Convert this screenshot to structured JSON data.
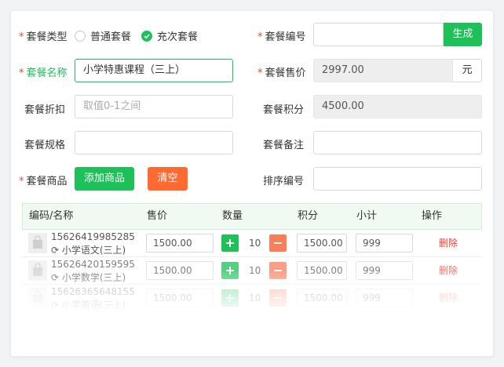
{
  "form": {
    "package_type": {
      "label": "套餐类型",
      "options": [
        "普通套餐",
        "充次套餐"
      ],
      "selected": 1
    },
    "package_code": {
      "label": "套餐编号",
      "value": "",
      "button": "生成"
    },
    "package_name": {
      "label": "套餐名称",
      "value": "小学特惠课程（三上）"
    },
    "package_price": {
      "label": "套餐售价",
      "value": "2997.00",
      "unit": "元"
    },
    "package_discount": {
      "label": "套餐折扣",
      "placeholder": "取值0-1之间"
    },
    "package_points": {
      "label": "套餐积分",
      "value": "4500.00"
    },
    "package_spec": {
      "label": "套餐规格",
      "value": ""
    },
    "package_note": {
      "label": "套餐备注",
      "value": ""
    },
    "package_goods": {
      "label": "套餐商品",
      "add_button": "添加商品",
      "clear_button": "清空"
    },
    "sort_number": {
      "label": "排序编号",
      "value": ""
    }
  },
  "table": {
    "headers": [
      "编码/名称",
      "售价",
      "数量",
      "积分",
      "小计",
      "操作"
    ],
    "rows": [
      {
        "code": "15626419985285",
        "name": "小学语文(三上)",
        "price": "1500.00",
        "qty": "10",
        "points": "1500.00",
        "subtotal": "999",
        "action": "删除"
      },
      {
        "code": "15626420159595",
        "name": "小学数学(三上)",
        "price": "1500.00",
        "qty": "10",
        "points": "1500.00",
        "subtotal": "999",
        "action": "删除"
      },
      {
        "code": "15626365648155",
        "name": "小学英语(三上)",
        "price": "1500.00",
        "qty": "10",
        "points": "1500.00",
        "subtotal": "999",
        "action": "删除"
      }
    ]
  },
  "colors": {
    "accent": "#1ec05a",
    "danger": "#ff6a33",
    "required": "#f04134"
  }
}
